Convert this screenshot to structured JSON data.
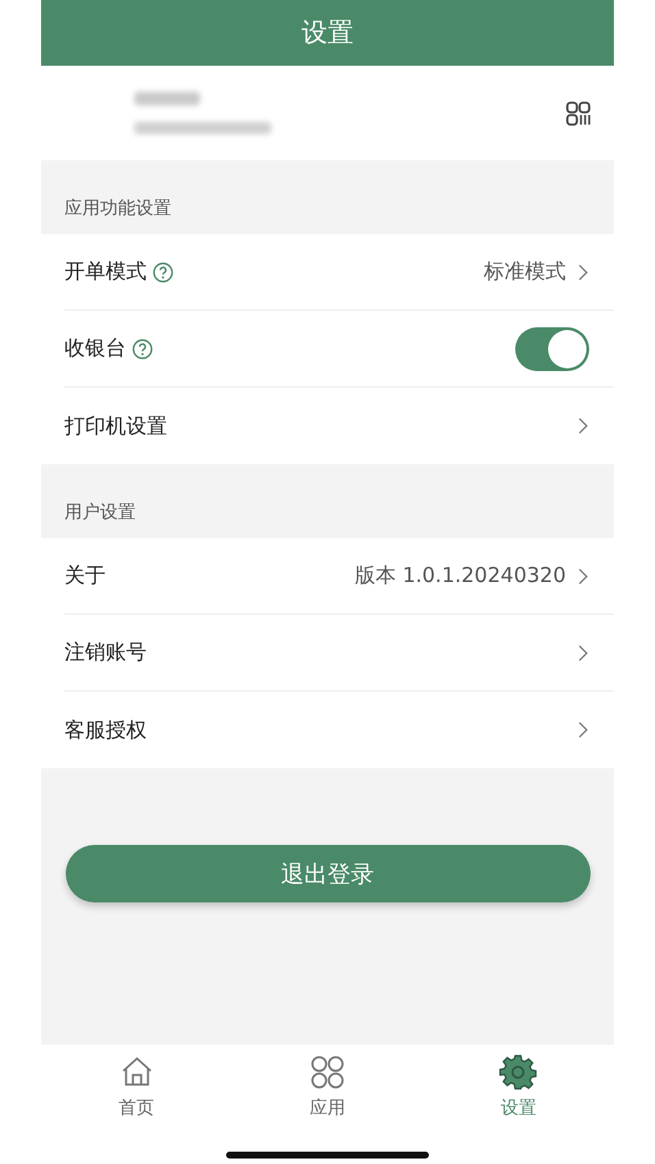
{
  "header": {
    "title": "设置"
  },
  "sections": [
    {
      "title": "应用功能设置",
      "rows": [
        {
          "kind": "value",
          "label": "开单模式",
          "help": true,
          "value": "标准模式"
        },
        {
          "kind": "toggle",
          "label": "收银台",
          "help": true,
          "on": true
        },
        {
          "kind": "link",
          "label": "打印机设置",
          "help": false
        }
      ]
    },
    {
      "title": "用户设置",
      "rows": [
        {
          "kind": "value",
          "label": "关于",
          "help": false,
          "value": "版本 1.0.1.20240320"
        },
        {
          "kind": "link",
          "label": "注销账号",
          "help": false
        },
        {
          "kind": "link",
          "label": "客服授权",
          "help": false
        }
      ]
    }
  ],
  "logout_button": "退出登录",
  "tab_bar": [
    {
      "kind": "home",
      "label": "首页",
      "selected": false
    },
    {
      "kind": "apps",
      "label": "应用",
      "selected": false
    },
    {
      "kind": "settings",
      "label": "设置",
      "selected": true
    }
  ]
}
